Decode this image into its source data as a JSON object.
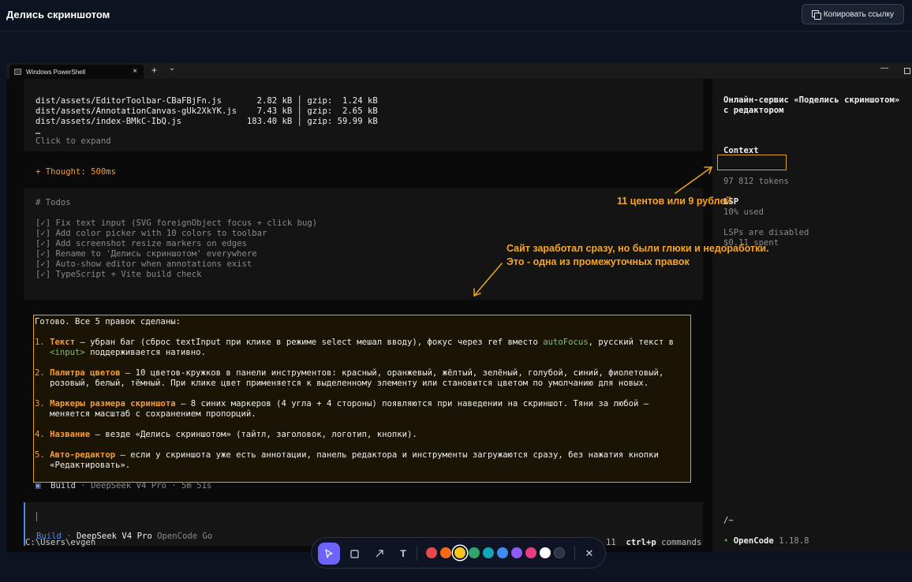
{
  "header": {
    "title": "Делись скриншотом",
    "copy_button": "Копировать ссылку"
  },
  "terminal": {
    "tab_title": "Windows PowerShell",
    "tab_close": "×",
    "new_tab": "+",
    "tab_dropdown": "⌄",
    "minimize": "—",
    "build_output": [
      "dist/assets/EditorToolbar-CBaFBjFn.js       2.82 kB │ gzip:  1.24 kB",
      "dist/assets/AnnotationCanvas-gUk2XkYK.js    7.43 kB │ gzip:  2.65 kB",
      "dist/assets/index-BMkC-IbQ.js             183.40 kB │ gzip: 59.99 kB",
      "…"
    ],
    "expand_hint": "Click to expand",
    "thought": "+ Thought: 500ms",
    "todos_title": "# Todos",
    "todos": [
      "[✓] Fix text input (SVG foreignObject focus + click bug)",
      "[✓] Add color picker with 10 colors to toolbar",
      "[✓] Add screenshot resize markers on edges",
      "[✓] Rename to 'Делись скриншотом' everywhere",
      "[✓] Auto-show editor when annotations exist",
      "[✓] TypeScript + Vite build check"
    ],
    "answer": {
      "intro": "Готово. Все 5 правок сделаны:",
      "items": [
        {
          "num": "1.",
          "head": "Текст",
          "l1a": " — убран баг (сброс textInput при клике в режиме select мешал вводу), фокус через ref вместо ",
          "code1": "autoFocus",
          "l1b": ", русский текст в",
          "code2": "<input>",
          "l2": " поддерживается нативно."
        },
        {
          "num": "2.",
          "head": "Палитра цветов",
          "l1": " — 10 цветов-кружков в панели инструментов: красный, оранжевый, жёлтый, зелёный, голубой, синий, фиолетовый,",
          "l2": "розовый, белый, тёмный. При клике цвет применяется к выделенному элементу или становится цветом по умолчанию для новых."
        },
        {
          "num": "3.",
          "head": "Маркеры размера скриншота",
          "l1": " — 8 синих маркеров (4 угла + 4 стороны) появляются при наведении на скриншот. Тяни за любой —",
          "l2": "меняется масштаб с сохранением пропорций."
        },
        {
          "num": "4.",
          "head": "Название",
          "l1": " — везде «Делись скриншотом» (тайтл, заголовок, логотип, кнопки)."
        },
        {
          "num": "5.",
          "head": "Авто-редактор",
          "l1": " — если у скриншота уже есть аннотации, панель редактора и инструменты загружаются сразу, без нажатия кнопки",
          "l2": "«Редактировать»."
        }
      ]
    },
    "build_status": {
      "icon": "▣",
      "mode": "Build",
      "rest": " · DeepSeek V4 Pro · 5m 51s"
    },
    "input_meta": {
      "mode": "Build",
      "sep": " · ",
      "model": "DeepSeek V4 Pro",
      "provider": " OpenCode Go"
    },
    "cwd": "C:\\Users\\evgen",
    "hint_num": "11",
    "hint_keys": "ctrl+p",
    "hint_label": " commands"
  },
  "sidebar": {
    "title_l1": "Онлайн-сервис «Поделись скриншотом»",
    "title_l2": "с редактором",
    "context_label": "Context",
    "tokens": "97 812 tokens",
    "used": "10% used",
    "spent": "$0.11 spent",
    "lsp_label": "LSP",
    "lsp_status": "LSPs are disabled",
    "cwd_short": "/~",
    "version_dot": "•",
    "version_name": "OpenCode",
    "version": " 1.18.8"
  },
  "annotations": {
    "note_cost": "11 центов или 9 рублей",
    "note_main_l1": "Сайт заработал сразу, но были глюки и недоработки.",
    "note_main_l2": "Это - одна из промежуточных правок"
  },
  "toolbar": {
    "select_tool": "select-arrow-icon",
    "rect_tool": "rectangle-icon",
    "arrow_tool": "arrow-icon",
    "text_tool": "T",
    "close": "✕",
    "colors": [
      "#e5484d",
      "#f76b15",
      "#f5c518",
      "#30a46c",
      "#12a5b5",
      "#3e8cf0",
      "#8e5cf0",
      "#e93d82",
      "#ffffff",
      "#2b3344"
    ],
    "selected_color": "#f5c518",
    "annotation_color": "#e3a21a"
  }
}
